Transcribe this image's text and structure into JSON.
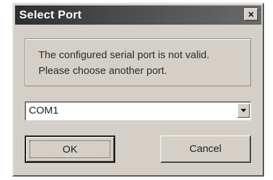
{
  "window": {
    "title": "Select Port",
    "close_label": "×"
  },
  "message": {
    "line1": "The configured serial port is not valid.",
    "line2": "Please choose another port."
  },
  "port_select": {
    "selected_value": "COM1"
  },
  "buttons": {
    "ok_label": "OK",
    "cancel_label": "Cancel"
  },
  "icons": {
    "close": "close-icon",
    "dropdown": "chevron-down-icon"
  }
}
